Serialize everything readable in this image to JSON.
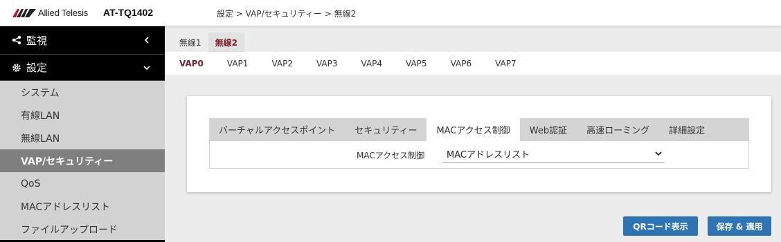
{
  "header": {
    "brand": "Allied Telesis",
    "model": "AT-TQ1402",
    "breadcrumb": "設定 > VAP/セキュリティー > 無線2"
  },
  "sidebar": {
    "monitor": {
      "label": "監視",
      "icon": "share-icon",
      "chevron": "chevron-left-icon"
    },
    "settings": {
      "label": "設定",
      "icon": "gear-icon",
      "chevron": "chevron-down-icon"
    },
    "items": [
      {
        "label": "システム"
      },
      {
        "label": "有線LAN"
      },
      {
        "label": "無線LAN"
      },
      {
        "label": "VAP/セキュリティー"
      },
      {
        "label": "QoS"
      },
      {
        "label": "MACアドレスリスト"
      },
      {
        "label": "ファイルアップロード"
      }
    ],
    "active_item": "VAP/セキュリティー"
  },
  "radio_tabs": [
    {
      "label": "無線1"
    },
    {
      "label": "無線2"
    }
  ],
  "active_radio_tab": "無線2",
  "vap_tabs": [
    {
      "label": "VAP0"
    },
    {
      "label": "VAP1"
    },
    {
      "label": "VAP2"
    },
    {
      "label": "VAP3"
    },
    {
      "label": "VAP4"
    },
    {
      "label": "VAP5"
    },
    {
      "label": "VAP6"
    },
    {
      "label": "VAP7"
    }
  ],
  "active_vap_tab": "VAP0",
  "inner_tabs": [
    {
      "label": "バーチャルアクセスポイント"
    },
    {
      "label": "セキュリティー"
    },
    {
      "label": "MACアクセス制御"
    },
    {
      "label": "Web認証"
    },
    {
      "label": "高速ローミング"
    },
    {
      "label": "詳細設定"
    }
  ],
  "active_inner_tab": "MACアクセス制御",
  "form": {
    "mac_access_label": "MACアクセス制御",
    "mac_access_value": "MACアドレスリスト"
  },
  "buttons": {
    "qr_label": "QRコード表示",
    "save_label": "保存 & 適用"
  },
  "colors": {
    "accent": "#7a1e2e",
    "button": "#2e74b5",
    "sidebar_dark": "#000000",
    "sidebar_active": "#7f7f7f"
  }
}
